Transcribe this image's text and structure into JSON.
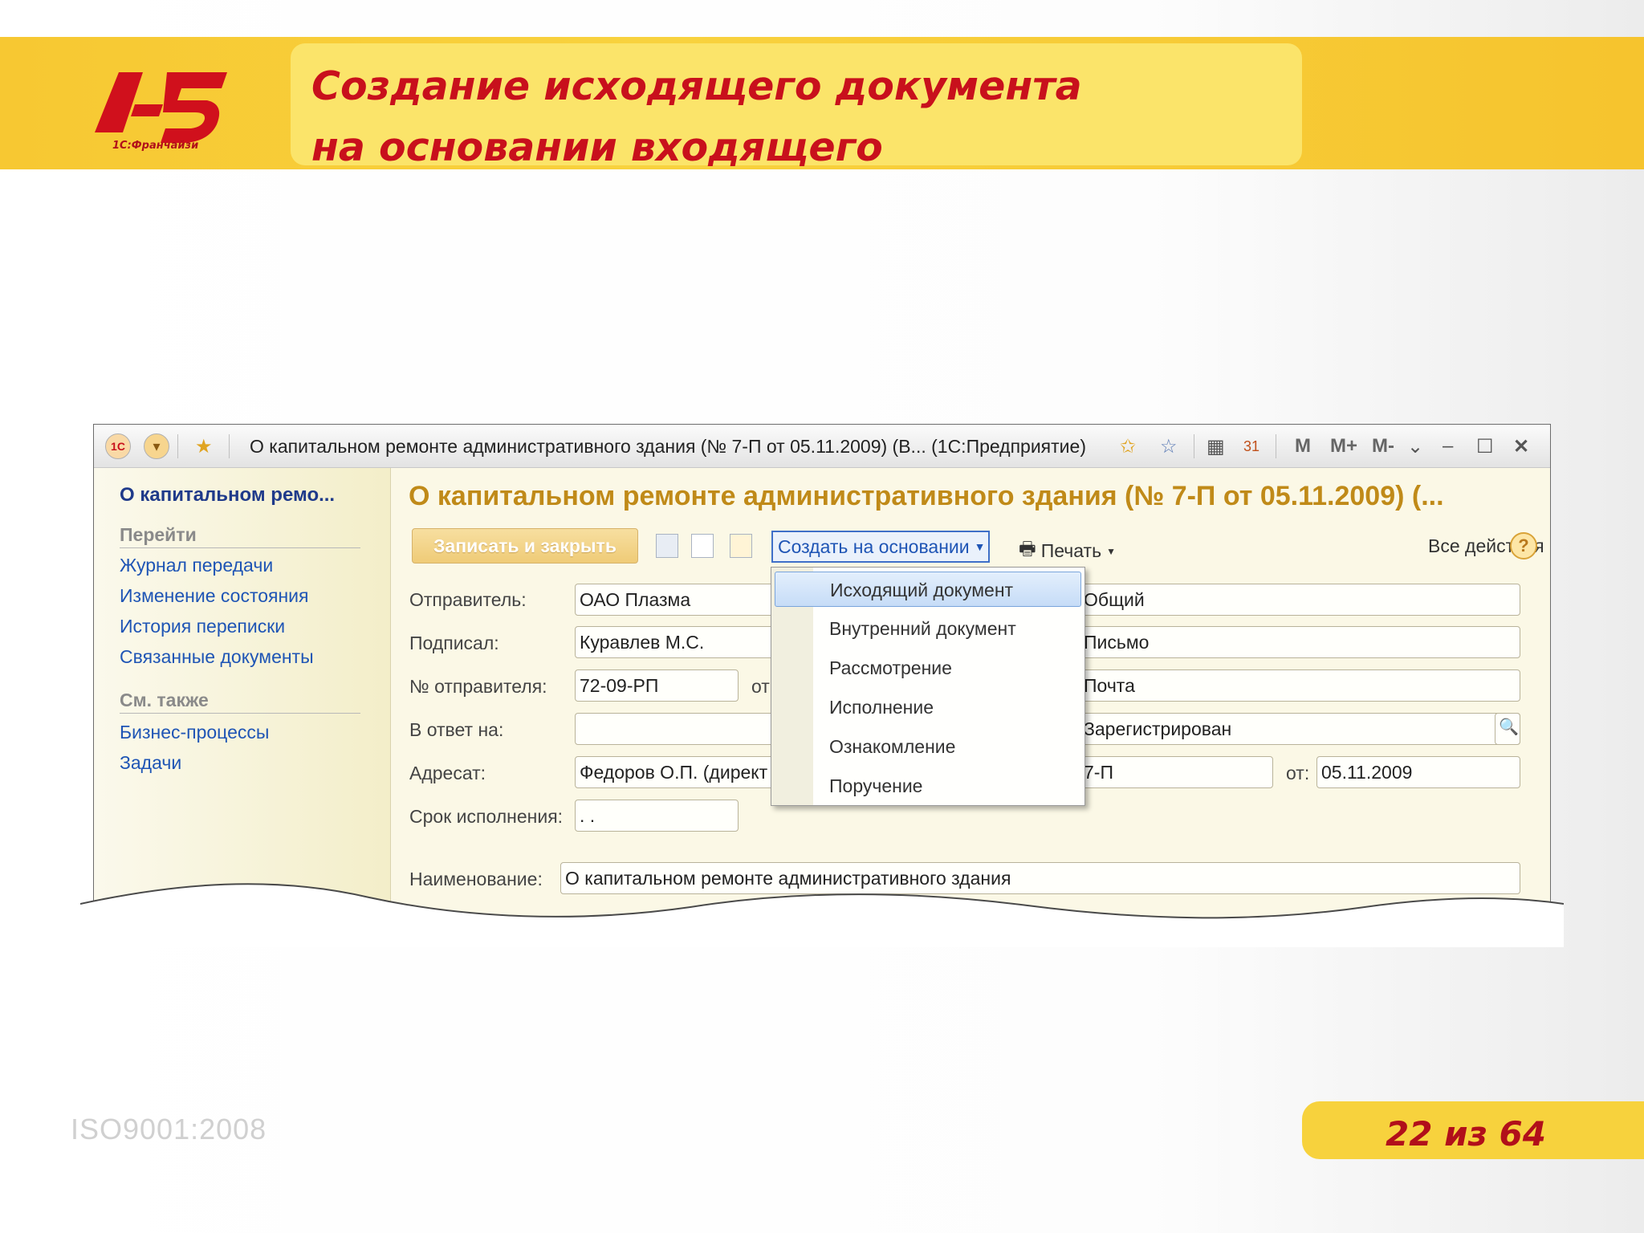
{
  "slide": {
    "title_line1": "Создание исходящего документа",
    "title_line2": "на основании входящего",
    "logo_caption": "1С:Франчайзи",
    "iso": "ISO9001:2008",
    "page": "22 из 64"
  },
  "window": {
    "title": "О капитальном ремонте административного здания (№ 7-П от 05.11.2009) (В...  (1С:Предприятие)",
    "m_labels": [
      "M",
      "M+",
      "M-"
    ]
  },
  "nav": {
    "title": "О капитальном ремо...",
    "goto_header": "Перейти",
    "goto_links": [
      "Журнал передачи",
      "Изменение состояния",
      "История переписки",
      "Связанные документы"
    ],
    "see_also_header": "См. также",
    "see_also_links": [
      "Бизнес-процессы",
      "Задачи"
    ]
  },
  "form": {
    "title": "О капитальном ремонте административного здания (№ 7-П от 05.11.2009) (...",
    "toolbar": {
      "save_close": "Записать и закрыть",
      "create_based": "Создать на основании",
      "print": "Печать",
      "all_actions": "Все действия"
    },
    "labels": {
      "sender": "Отправитель:",
      "signed": "Подписал:",
      "sender_no": "№ отправителя:",
      "date_from_partial": "от",
      "reply_to": "В ответ на:",
      "addressee": "Адресат:",
      "deadline": "Срок исполнения:",
      "name": "Наименование:",
      "reg_date": "от:"
    },
    "values": {
      "sender": "ОАО Плазма",
      "signed": "Куравлев М.С.",
      "sender_no": "72-09-РП",
      "reply_to": "",
      "addressee": "Федоров О.П. (директ",
      "deadline": " .  .",
      "name": "О капитальном ремонте административного здания",
      "access": "Общий",
      "kind": "Письмо",
      "delivery": "Почта",
      "state": "Зарегистрирован",
      "reg_no": "7-П",
      "reg_date": "05.11.2009"
    },
    "menu": {
      "items": [
        "Исходящий документ",
        "Внутренний документ",
        "Рассмотрение",
        "Исполнение",
        "Ознакомление",
        "Поручение"
      ],
      "selected": "Исходящий документ"
    }
  },
  "colors": {
    "accent_red": "#c8101c",
    "band_yellow": "#f7c832",
    "link_blue": "#1f55b5",
    "form_title": "#c08a18"
  }
}
